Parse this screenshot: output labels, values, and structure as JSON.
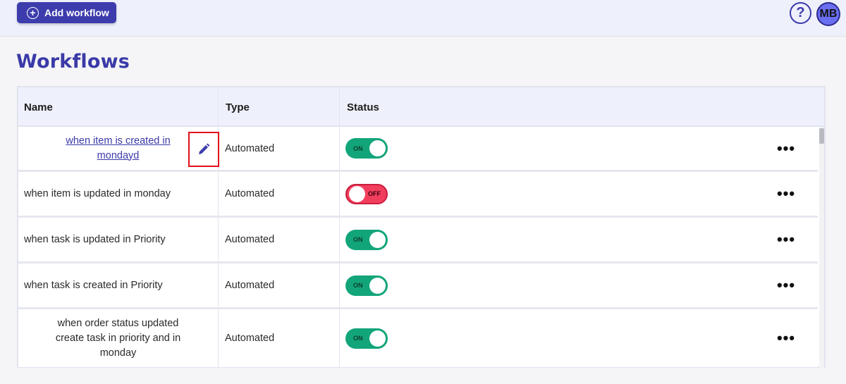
{
  "topbar": {
    "add_label": "Add workflow",
    "help_glyph": "?",
    "avatar_initials": "MB"
  },
  "page": {
    "title": "Workflows"
  },
  "table": {
    "headers": {
      "name": "Name",
      "type": "Type",
      "status": "Status"
    },
    "rows": [
      {
        "name": "when item is created in mondayd",
        "type": "Automated",
        "status": "ON",
        "is_link": true
      },
      {
        "name": "when item is updated in monday",
        "type": "Automated",
        "status": "OFF",
        "is_link": false
      },
      {
        "name": "when task is updated in Priority",
        "type": "Automated",
        "status": "ON",
        "is_link": false
      },
      {
        "name": "when task is created in Priority",
        "type": "Automated",
        "status": "ON",
        "is_link": false
      },
      {
        "name": "when order status updated create task in priority and in monday",
        "type": "Automated",
        "status": "ON",
        "is_link": false
      }
    ],
    "more_glyph": "•••"
  },
  "colors": {
    "accent": "#3c3cad",
    "toggle_on": "#13a57a",
    "toggle_off": "#f23e5d",
    "highlight": "#e0101b"
  },
  "icons": [
    "plus-circle-icon",
    "help-icon",
    "pencil-icon",
    "more-icon"
  ]
}
